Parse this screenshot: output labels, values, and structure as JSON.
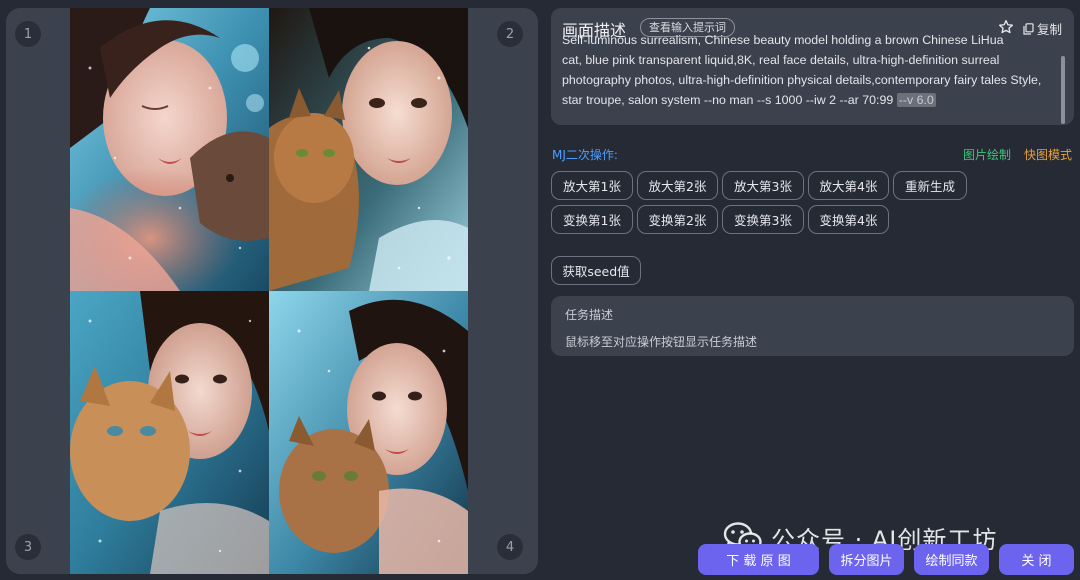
{
  "image_panel": {
    "badges": [
      "1",
      "2",
      "3",
      "4"
    ]
  },
  "description": {
    "title": "画面描述",
    "view_prompt_label": "查看输入提示词",
    "favorite_icon": "star-icon",
    "copy_label": "复制",
    "text_line_clipped": "Self-luminous surrealism, Chinese beauty model holding a brown Chinese LiHua",
    "text_body": "cat, blue pink transparent liquid,8K, real face details, ultra-high-definition surreal photography photos, ultra-high-definition physical details,contemporary fairy tales Style, star troupe, salon system --no man --s 1000 --iw 2 --ar 70:99 ",
    "version_tag": "--v 6.0"
  },
  "mj_ops": {
    "label": "MJ二次操作:",
    "paint_mode": "图片绘制",
    "fast_mode": "快图模式",
    "row1": [
      "放大第1张",
      "放大第2张",
      "放大第3张",
      "放大第4张",
      "重新生成"
    ],
    "row2": [
      "变换第1张",
      "变换第2张",
      "变换第3张",
      "变换第4张"
    ],
    "seed": "获取seed值"
  },
  "task": {
    "title": "任务描述",
    "text": "鼠标移至对应操作按钮显示任务描述"
  },
  "watermark": {
    "text": "公众号 · AI创新工坊",
    "icon": "wechat-icon"
  },
  "bottom_buttons": {
    "download": "下 载 原 图",
    "split": "拆分图片",
    "draw_same": "绘制同款",
    "close": "关 闭"
  },
  "colors": {
    "accent_button": "#6c64ee",
    "mj_label": "#4a9fff",
    "paint_mode": "#39c97a",
    "fast_mode": "#e7a23a"
  }
}
